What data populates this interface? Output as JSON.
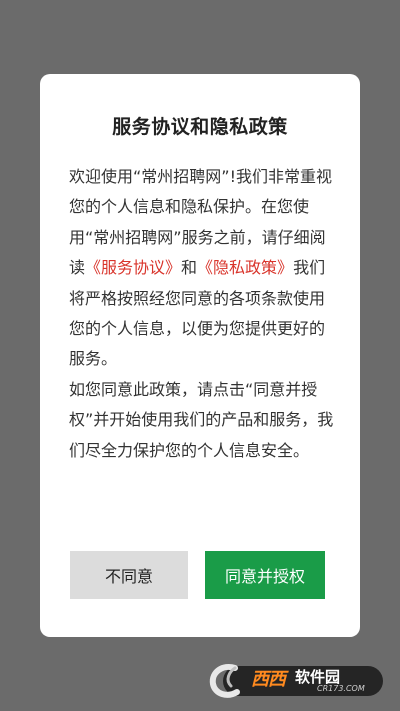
{
  "dialog": {
    "title": "服务协议和隐私政策",
    "para1_start": "欢迎使用“常州招聘网”!我们非常重视您的个人信息和隐私保护。在您使用“常州招聘网”服务之前，请仔细阅读",
    "service_link": "《服务协议》",
    "and": "和",
    "privacy_link": "《隐私政策》",
    "para1_end": "我们将严格按照经您同意的各项条款使用您的个人信息，以便为您提供更好的服务。",
    "para2": "如您同意此政策，请点击“同意并授权”并开始使用我们的产品和服务，我们尽全力保护您的个人信息安全。",
    "disagree_label": "不同意",
    "agree_label": "同意并授权"
  },
  "watermark": {
    "logo": "西西",
    "name": "软件园",
    "url": "CR173.COM"
  },
  "colors": {
    "overlay": "#6b6b6b",
    "link": "#d9342b",
    "agree_button": "#1a9c48",
    "disagree_button": "#dcdcdc"
  }
}
